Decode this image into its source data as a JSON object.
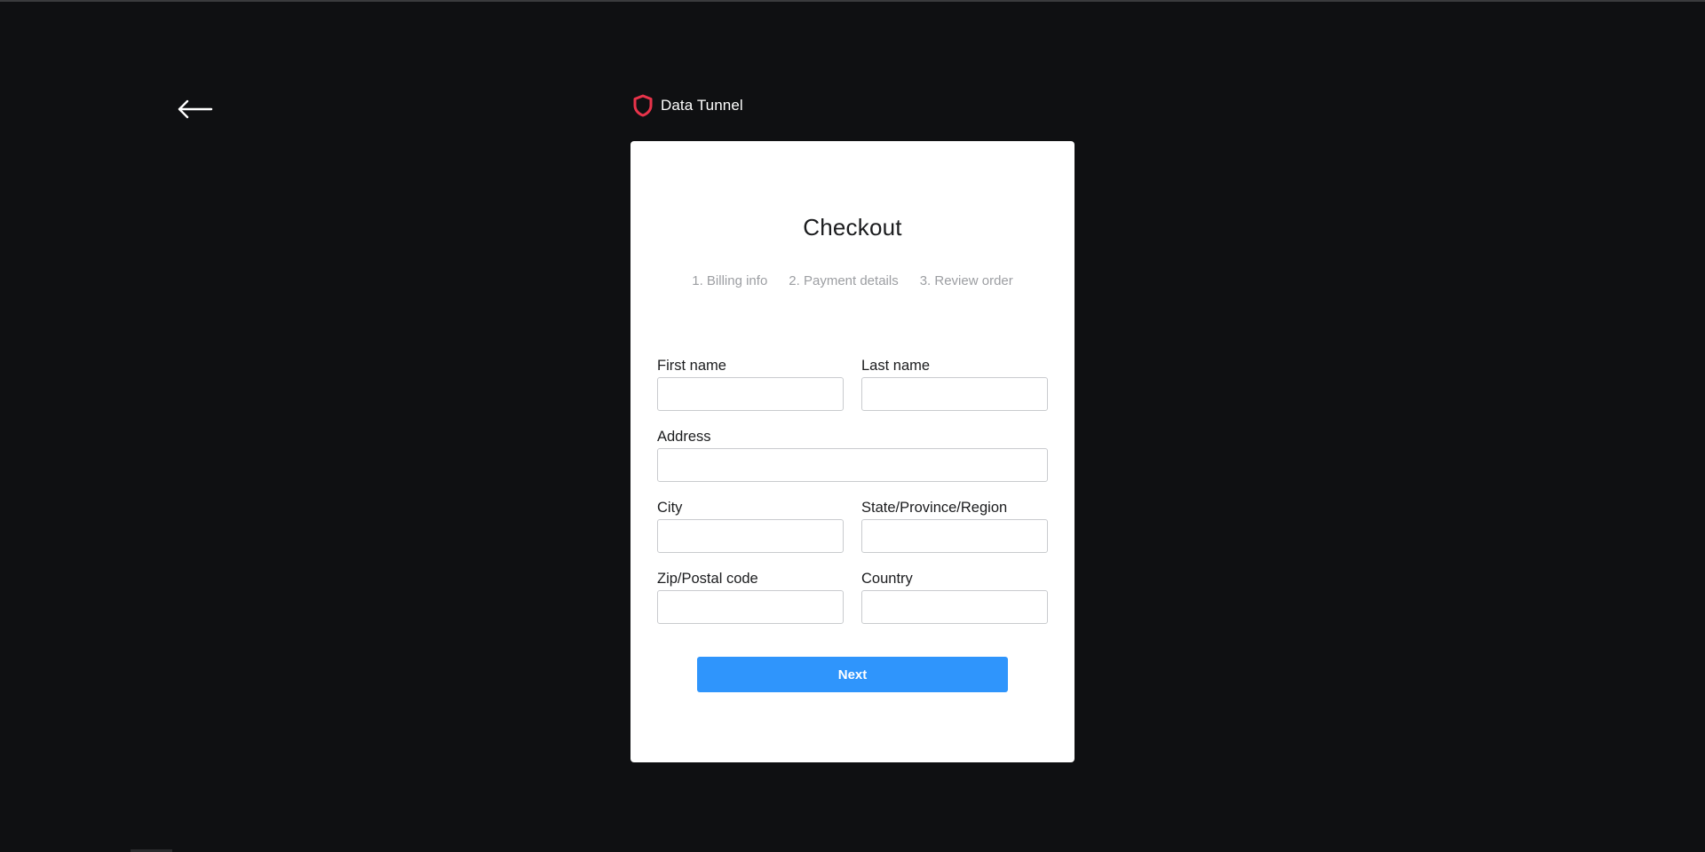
{
  "brand": {
    "name": "Data Tunnel",
    "icon": "shield-icon",
    "icon_color": "#e8334a"
  },
  "nav": {
    "back_icon": "arrow-left-icon"
  },
  "checkout": {
    "title": "Checkout",
    "steps": [
      "1. Billing info",
      "2. Payment details",
      "3. Review order"
    ],
    "fields": {
      "first_name": {
        "label": "First name",
        "value": ""
      },
      "last_name": {
        "label": "Last name",
        "value": ""
      },
      "address": {
        "label": "Address",
        "value": ""
      },
      "city": {
        "label": "City",
        "value": ""
      },
      "state": {
        "label": "State/Province/Region",
        "value": ""
      },
      "zip": {
        "label": "Zip/Postal code",
        "value": ""
      },
      "country": {
        "label": "Country",
        "value": ""
      }
    },
    "next_label": "Next"
  },
  "colors": {
    "background": "#0f1012",
    "card": "#ffffff",
    "accent": "#2f95fc",
    "muted_text": "#9c9ea2"
  }
}
